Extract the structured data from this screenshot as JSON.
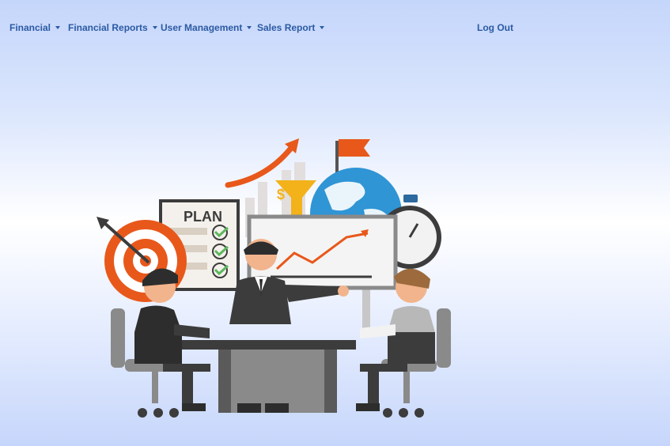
{
  "navbar": {
    "menus": [
      {
        "label": "Financial",
        "icon": "caret-down-icon"
      },
      {
        "label": "Financial Reports",
        "icon": "caret-down-icon"
      },
      {
        "label": "User Management",
        "icon": "caret-down-icon"
      },
      {
        "label": "Sales Report",
        "icon": "caret-down-icon"
      }
    ],
    "logout_label": "Log Out"
  },
  "illustration": {
    "plan_label": "PLAN"
  },
  "colors": {
    "nav_text": "#2b5aa3",
    "accent_orange": "#e8581b",
    "globe_blue": "#2f95d5",
    "dark_gray": "#3b3b3b"
  }
}
